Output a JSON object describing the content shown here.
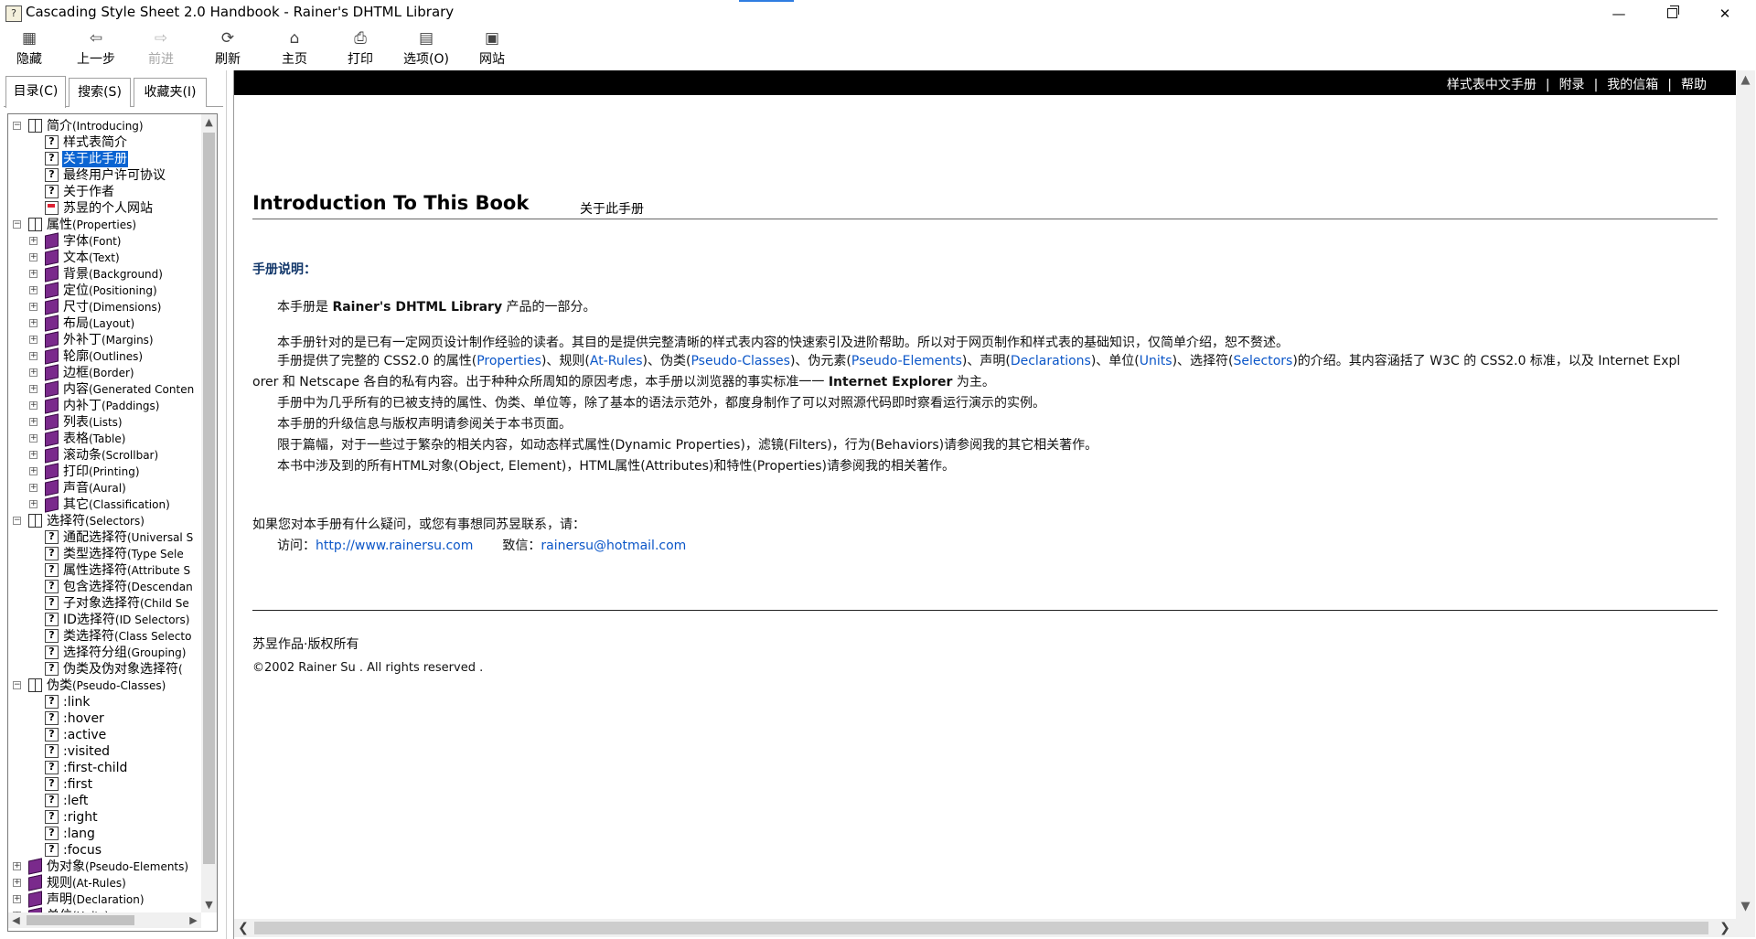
{
  "window": {
    "title": "Cascading Style Sheet 2.0 Handbook - Rainer's DHTML Library",
    "app_icon": "help-book-icon",
    "minimize_glyph": "—",
    "close_glyph": "✕"
  },
  "toolbar": {
    "hide": {
      "label": "隐藏",
      "icon": "hide-pane-icon",
      "glyph": "▦"
    },
    "back": {
      "label": "上一步",
      "icon": "back-arrow-icon",
      "glyph": "⇦"
    },
    "forward": {
      "label": "前进",
      "icon": "forward-arrow-icon",
      "glyph": "⇨"
    },
    "refresh": {
      "label": "刷新",
      "icon": "refresh-icon",
      "glyph": "⟳"
    },
    "home": {
      "label": "主页",
      "icon": "home-icon",
      "glyph": "⌂"
    },
    "print": {
      "label": "打印",
      "icon": "printer-icon",
      "glyph": "⎙"
    },
    "options": {
      "label": "选项(O)",
      "icon": "options-icon",
      "glyph": "▤"
    },
    "site": {
      "label": "网站",
      "icon": "website-icon",
      "glyph": "▣"
    }
  },
  "nav": {
    "tabs": [
      {
        "label": "目录(C)",
        "active": true
      },
      {
        "label": "搜索(S)",
        "active": false
      },
      {
        "label": "收藏夹(I)",
        "active": false
      }
    ],
    "tree": [
      {
        "level": 0,
        "type": "book-open",
        "expander": "−",
        "name": "简介",
        "en": "(Introducing)"
      },
      {
        "level": 1,
        "type": "page",
        "name": "样式表简介",
        "en": ""
      },
      {
        "level": 1,
        "type": "page",
        "name": "关于此手册",
        "en": "",
        "selected": true
      },
      {
        "level": 1,
        "type": "page",
        "name": "最终用户许可协议",
        "en": ""
      },
      {
        "level": 1,
        "type": "page",
        "name": "关于作者",
        "en": ""
      },
      {
        "level": 1,
        "type": "web",
        "name": "苏昱的个人网站",
        "en": ""
      },
      {
        "level": 0,
        "type": "book-open",
        "expander": "−",
        "name": "属性",
        "en": "(Properties)"
      },
      {
        "level": 1,
        "type": "book-closed",
        "expander": "+",
        "name": "字体",
        "en": "(Font)"
      },
      {
        "level": 1,
        "type": "book-closed",
        "expander": "+",
        "name": "文本",
        "en": "(Text)"
      },
      {
        "level": 1,
        "type": "book-closed",
        "expander": "+",
        "name": "背景",
        "en": "(Background)"
      },
      {
        "level": 1,
        "type": "book-closed",
        "expander": "+",
        "name": "定位",
        "en": "(Positioning)"
      },
      {
        "level": 1,
        "type": "book-closed",
        "expander": "+",
        "name": "尺寸",
        "en": "(Dimensions)"
      },
      {
        "level": 1,
        "type": "book-closed",
        "expander": "+",
        "name": "布局",
        "en": "(Layout)"
      },
      {
        "level": 1,
        "type": "book-closed",
        "expander": "+",
        "name": "外补丁",
        "en": "(Margins)"
      },
      {
        "level": 1,
        "type": "book-closed",
        "expander": "+",
        "name": "轮廓",
        "en": "(Outlines)"
      },
      {
        "level": 1,
        "type": "book-closed",
        "expander": "+",
        "name": "边框",
        "en": "(Border)"
      },
      {
        "level": 1,
        "type": "book-closed",
        "expander": "+",
        "name": "内容",
        "en": "(Generated Conten"
      },
      {
        "level": 1,
        "type": "book-closed",
        "expander": "+",
        "name": "内补丁",
        "en": "(Paddings)"
      },
      {
        "level": 1,
        "type": "book-closed",
        "expander": "+",
        "name": "列表",
        "en": "(Lists)"
      },
      {
        "level": 1,
        "type": "book-closed",
        "expander": "+",
        "name": "表格",
        "en": "(Table)"
      },
      {
        "level": 1,
        "type": "book-closed",
        "expander": "+",
        "name": "滚动条",
        "en": "(Scrollbar)"
      },
      {
        "level": 1,
        "type": "book-closed",
        "expander": "+",
        "name": "打印",
        "en": "(Printing)"
      },
      {
        "level": 1,
        "type": "book-closed",
        "expander": "+",
        "name": "声音",
        "en": "(Aural)"
      },
      {
        "level": 1,
        "type": "book-closed",
        "expander": "+",
        "name": "其它",
        "en": "(Classification)"
      },
      {
        "level": 0,
        "type": "book-open",
        "expander": "−",
        "name": "选择符",
        "en": "(Selectors)"
      },
      {
        "level": 1,
        "type": "page",
        "name": "通配选择符",
        "en": "(Universal S"
      },
      {
        "level": 1,
        "type": "page",
        "name": "类型选择符",
        "en": "(Type Sele"
      },
      {
        "level": 1,
        "type": "page",
        "name": "属性选择符",
        "en": "(Attribute S"
      },
      {
        "level": 1,
        "type": "page",
        "name": "包含选择符",
        "en": "(Descendan"
      },
      {
        "level": 1,
        "type": "page",
        "name": "子对象选择符",
        "en": "(Child Se"
      },
      {
        "level": 1,
        "type": "page",
        "name": "ID选择符",
        "en": "(ID Selectors)"
      },
      {
        "level": 1,
        "type": "page",
        "name": "类选择符",
        "en": "(Class Selecto"
      },
      {
        "level": 1,
        "type": "page",
        "name": "选择符分组",
        "en": "(Grouping)"
      },
      {
        "level": 1,
        "type": "page",
        "name": "伪类及伪对象选择符",
        "en": "("
      },
      {
        "level": 0,
        "type": "book-open",
        "expander": "−",
        "name": "伪类",
        "en": "(Pseudo-Classes)"
      },
      {
        "level": 1,
        "type": "page",
        "name": ":link",
        "en": ""
      },
      {
        "level": 1,
        "type": "page",
        "name": ":hover",
        "en": ""
      },
      {
        "level": 1,
        "type": "page",
        "name": ":active",
        "en": ""
      },
      {
        "level": 1,
        "type": "page",
        "name": ":visited",
        "en": ""
      },
      {
        "level": 1,
        "type": "page",
        "name": ":first-child",
        "en": ""
      },
      {
        "level": 1,
        "type": "page",
        "name": ":first",
        "en": ""
      },
      {
        "level": 1,
        "type": "page",
        "name": ":left",
        "en": ""
      },
      {
        "level": 1,
        "type": "page",
        "name": ":right",
        "en": ""
      },
      {
        "level": 1,
        "type": "page",
        "name": ":lang",
        "en": ""
      },
      {
        "level": 1,
        "type": "page",
        "name": ":focus",
        "en": ""
      },
      {
        "level": 0,
        "type": "book-closed",
        "expander": "+",
        "name": "伪对象",
        "en": "(Pseudo-Elements)"
      },
      {
        "level": 0,
        "type": "book-closed",
        "expander": "+",
        "name": "规则",
        "en": "(At-Rules)"
      },
      {
        "level": 0,
        "type": "book-closed",
        "expander": "+",
        "name": "声明",
        "en": "(Declaration)"
      },
      {
        "level": 0,
        "type": "book-closed",
        "expander": "+",
        "name": "单位",
        "en": "(Units)"
      }
    ]
  },
  "content": {
    "top_links": [
      "样式表中文手册",
      "附录",
      "我的信箱",
      "帮助"
    ],
    "top_separator": "|",
    "heading": "Introduction To This Book",
    "subheading": "关于此手册",
    "section_title": "手册说明：",
    "intro": {
      "pre": "本手册是 ",
      "product": "Rainer's DHTML Library",
      "post": " 产品的一部分。"
    },
    "p_audience": "本手册针对的是已有一定网页设计制作经验的读者。其目的是提供完整清晰的样式表内容的快速索引及进阶帮助。所以对于网页制作和样式表的基础知识，仅简单介绍，恕不赘述。",
    "p_scope": {
      "t0": "手册提供了完整的 CSS2.0 的属性(",
      "l0": "Properties",
      "t1": ")、规则(",
      "l1": "At-Rules",
      "t2": ")、伪类(",
      "l2": "Pseudo-Classes",
      "t3": ")、伪元素(",
      "l3": "Pseudo-Elements",
      "t4": ")、声明(",
      "l4": "Declarations",
      "t5": ")、单位(",
      "l5": "Units",
      "t6": ")、选择符(",
      "l6": "Selectors",
      "t7": ")的介绍。其内容涵括了 W3C 的 CSS2.0 标准，以及 Internet Expl",
      "line2_pre": "orer 和 Netscape 各自的私有内容。出于种种众所周知的原因考虑，本手册以浏览器的事实标准一一 ",
      "line2_strong": "Internet Explorer",
      "line2_post": " 为主。"
    },
    "p_examples": "手册中为几乎所有的已被支持的属性、伪类、单位等，除了基本的语法示范外，都度身制作了可以对照源代码即时察看运行演示的实例。",
    "p_upgrade": "本手册的升级信息与版权声明请参阅关于本书页面。",
    "p_limits": "限于篇幅，对于一些过于繁杂的相关内容，如动态样式属性(Dynamic Properties)，滤镜(Filters)，行为(Behaviors)请参阅我的其它相关著作。",
    "p_objects": "本书中涉及到的所有HTML对象(Object, Element)，HTML属性(Attributes)和特性(Properties)请参阅我的相关著作。",
    "contact_intro": "如果您对本手册有什么疑问，或您有事想同苏昱联系，请：",
    "contact": {
      "visit_label": "访问：",
      "visit_url": "http://www.rainersu.com",
      "mail_label": "致信：",
      "mail": "rainersu@hotmail.com"
    },
    "footer_line1": "苏昱作品·版权所有",
    "footer_line2": "©2002 Rainer Su . All rights reserved ."
  },
  "colors": {
    "selection": "#0a64d2",
    "link": "#0b56c8",
    "section_title": "#12376a",
    "top_bar": "#000000",
    "book_icon": "#7a2a8c"
  }
}
